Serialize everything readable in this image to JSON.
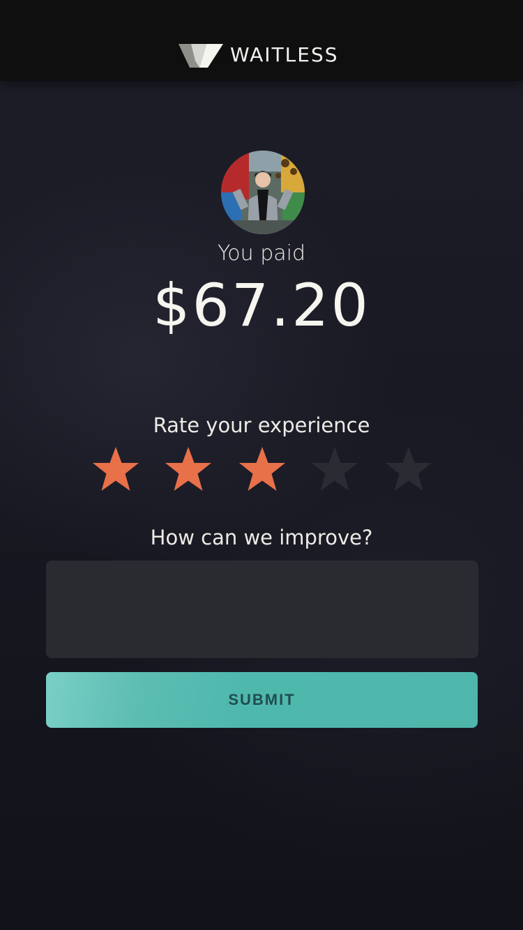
{
  "app": {
    "name": "WAITLESS"
  },
  "payment": {
    "label": "You paid",
    "amount": "$67.20"
  },
  "rating": {
    "label": "Rate your experience",
    "value": 3,
    "max": 5,
    "filled_color": "#e8714a",
    "empty_color": "#2b2b33"
  },
  "feedback": {
    "label": "How can we improve?",
    "value": "",
    "placeholder": ""
  },
  "submit": {
    "label": "SUBMIT"
  },
  "colors": {
    "header_bg": "#0f0f10",
    "accent": "#4fb8ad",
    "text": "#ecece6"
  }
}
